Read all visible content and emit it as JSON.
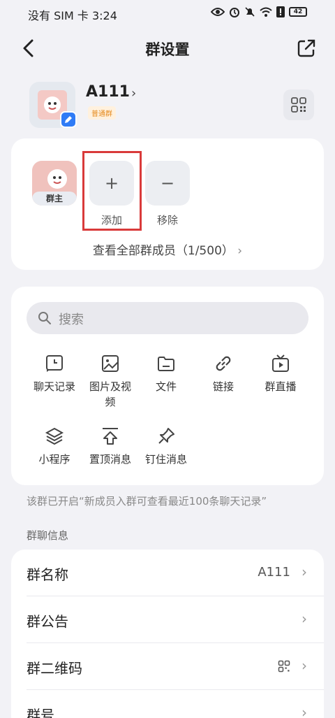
{
  "status_bar": {
    "carrier_time": "没有 SIM 卡 3:24",
    "battery": "42"
  },
  "nav": {
    "title": "群设置"
  },
  "group": {
    "name": "A111",
    "tag": "普通群"
  },
  "members": {
    "owner_badge": "群主",
    "add_label": "添加",
    "remove_label": "移除",
    "add_symbol": "+",
    "remove_symbol": "−",
    "view_all": "查看全部群成员（1/500）"
  },
  "search": {
    "placeholder": "搜索"
  },
  "tools": [
    {
      "label": "聊天记录",
      "icon": "clock-doc-icon"
    },
    {
      "label": "图片及视频",
      "icon": "image-icon"
    },
    {
      "label": "文件",
      "icon": "folder-icon"
    },
    {
      "label": "链接",
      "icon": "link-icon"
    },
    {
      "label": "群直播",
      "icon": "tv-icon"
    },
    {
      "label": "小程序",
      "icon": "layers-icon"
    },
    {
      "label": "置顶消息",
      "icon": "pin-top-icon"
    },
    {
      "label": "钉住消息",
      "icon": "pushpin-icon"
    }
  ],
  "notice": "该群已开启“新成员入群可查看最近100条聊天记录”",
  "section_title": "群聊信息",
  "info_rows": [
    {
      "key": "群名称",
      "value": "A111"
    },
    {
      "key": "群公告",
      "value": ""
    },
    {
      "key": "群二维码",
      "value": ""
    },
    {
      "key": "群号",
      "value": ""
    }
  ],
  "colors": {
    "accent_blue": "#2f7bf6",
    "tag_orange": "#e58a1e",
    "highlight_red": "#d93a3a"
  }
}
